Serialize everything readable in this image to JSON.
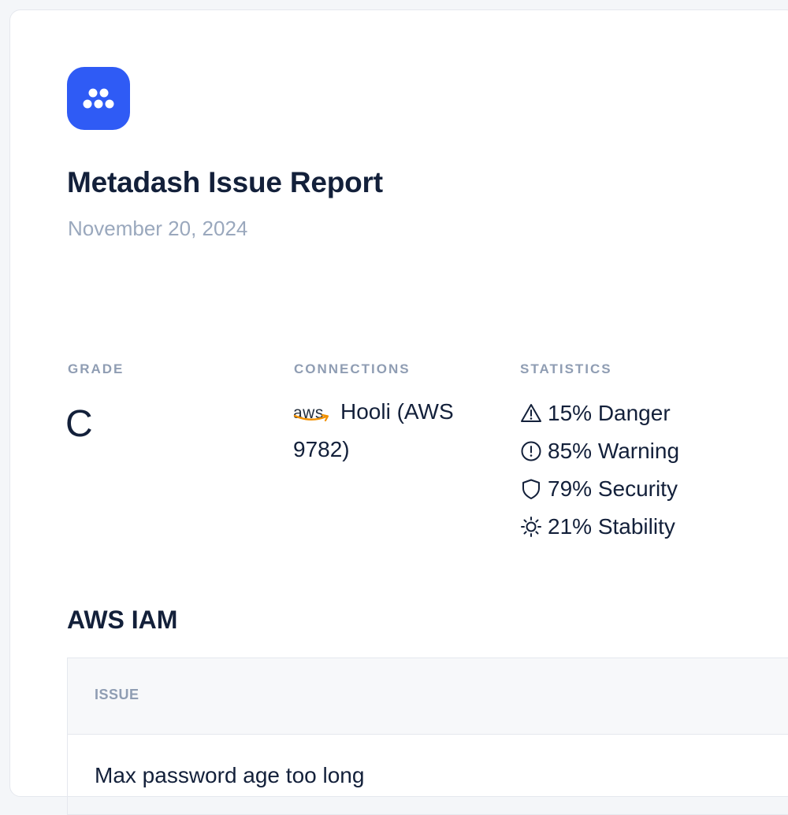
{
  "report": {
    "title": "Metadash Issue Report",
    "date": "November 20, 2024"
  },
  "brand": {
    "accent_color": "#2f5bf5",
    "logo_icon": "dots-logo-icon"
  },
  "grade": {
    "label": "GRADE",
    "value": "C"
  },
  "connections": {
    "label": "CONNECTIONS",
    "items": [
      {
        "icon": "aws-logo-icon",
        "logo_text": "aws",
        "name": "Hooli (AWS 9782)"
      }
    ]
  },
  "statistics": {
    "label": "STATISTICS",
    "items": [
      {
        "icon": "warning-triangle-icon",
        "text": "15% Danger"
      },
      {
        "icon": "exclamation-circle-icon",
        "text": "85% Warning"
      },
      {
        "icon": "shield-icon",
        "text": "79% Security"
      },
      {
        "icon": "sun-icon",
        "text": "21% Stability"
      }
    ]
  },
  "sections": [
    {
      "title": "AWS IAM",
      "columns": [
        "ISSUE"
      ],
      "rows": [
        {
          "issue": "Max password age too long"
        }
      ]
    }
  ]
}
